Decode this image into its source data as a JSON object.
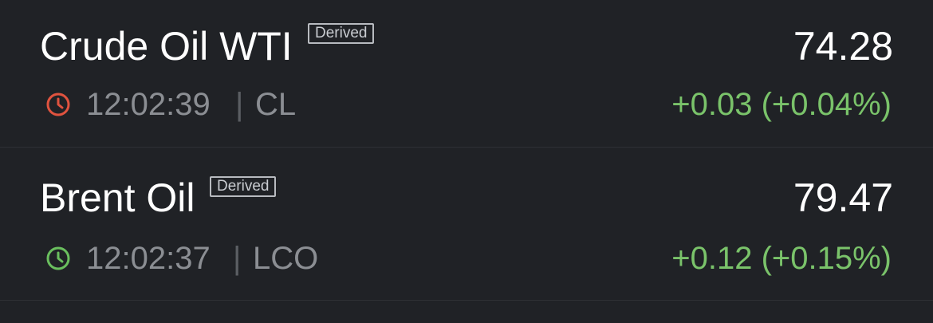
{
  "colors": {
    "background": "#202226",
    "positive": "#7ac36a",
    "clock_closed": "#e0533f",
    "clock_open": "#6abf5e",
    "muted_text": "#8b8e93"
  },
  "quotes": [
    {
      "name": "Crude Oil WTI",
      "badge": "Derived",
      "price": "74.28",
      "time": "12:02:39",
      "separator": "|",
      "symbol": "CL",
      "change": "+0.03 (+0.04%)",
      "clock_icon": "clock-icon",
      "clock_color": "#e0533f"
    },
    {
      "name": "Brent Oil",
      "badge": "Derived",
      "price": "79.47",
      "time": "12:02:37",
      "separator": "|",
      "symbol": "LCO",
      "change": "+0.12 (+0.15%)",
      "clock_icon": "clock-icon",
      "clock_color": "#6abf5e"
    }
  ]
}
